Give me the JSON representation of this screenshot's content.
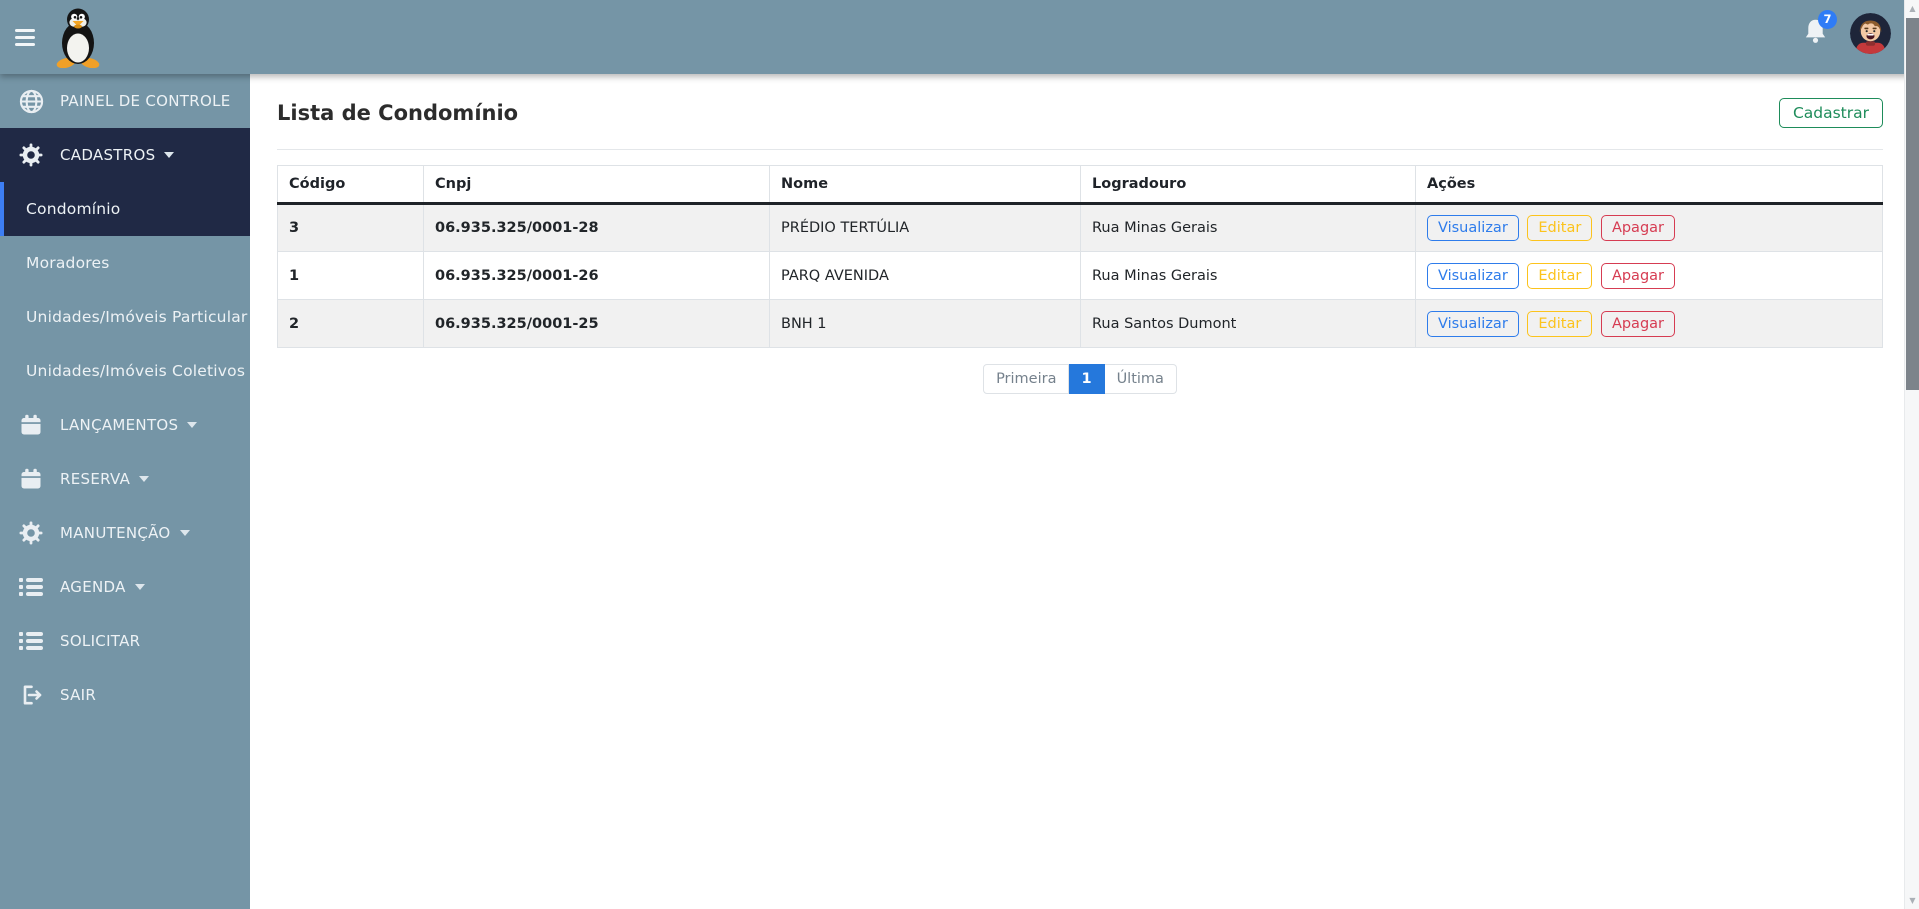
{
  "topbar": {
    "notification_count": "7",
    "logo_alt": "tux-penguin-logo"
  },
  "sidebar": {
    "items": [
      {
        "label": "PAINEL DE CONTROLE",
        "icon": "globe-icon"
      },
      {
        "label": "CADASTROS",
        "icon": "gear-icon",
        "caret": true
      },
      {
        "label": "Condomínio",
        "submenu": true,
        "active": true
      },
      {
        "label": "Moradores",
        "submenu": true
      },
      {
        "label": "Unidades/Imóveis Particular",
        "submenu": true
      },
      {
        "label": "Unidades/Imóveis Coletivos",
        "submenu": true
      },
      {
        "label": "LANÇAMENTOS",
        "icon": "calendar-icon",
        "caret": true
      },
      {
        "label": "RESERVA",
        "icon": "calendar-icon",
        "caret": true
      },
      {
        "label": "MANUTENÇÃO",
        "icon": "gear-icon",
        "caret": true
      },
      {
        "label": "AGENDA",
        "icon": "list-icon",
        "caret": true
      },
      {
        "label": "SOLICITAR",
        "icon": "list-icon"
      },
      {
        "label": "SAIR",
        "icon": "logout-icon"
      }
    ]
  },
  "page": {
    "title": "Lista de Condomínio",
    "register_button": "Cadastrar"
  },
  "table": {
    "headers": [
      "Código",
      "Cnpj",
      "Nome",
      "Logradouro",
      "Ações"
    ],
    "actions": {
      "view": "Visualizar",
      "edit": "Editar",
      "delete": "Apagar"
    },
    "rows": [
      {
        "codigo": "3",
        "cnpj": "06.935.325/0001-28",
        "nome": "PRÉDIO TERTÚLIA",
        "logradouro": "Rua Minas Gerais"
      },
      {
        "codigo": "1",
        "cnpj": "06.935.325/0001-26",
        "nome": "PARQ AVENIDA",
        "logradouro": "Rua Minas Gerais"
      },
      {
        "codigo": "2",
        "cnpj": "06.935.325/0001-25",
        "nome": "BNH 1",
        "logradouro": "Rua Santos Dumont"
      }
    ]
  },
  "pagination": {
    "first": "Primeira",
    "current": "1",
    "last": "Última"
  },
  "colors": {
    "topbar": "#7595a6",
    "sidebar_dark_section": "#202945",
    "active_indicator": "#3d7ef4",
    "primary": "#2e7ceb",
    "warning": "#fcc31c",
    "danger": "#d63c52",
    "success": "#1e8c5a",
    "badge": "#2f7cf6",
    "pagination_active": "#2578dc",
    "stripe": "#f1f1f1"
  }
}
